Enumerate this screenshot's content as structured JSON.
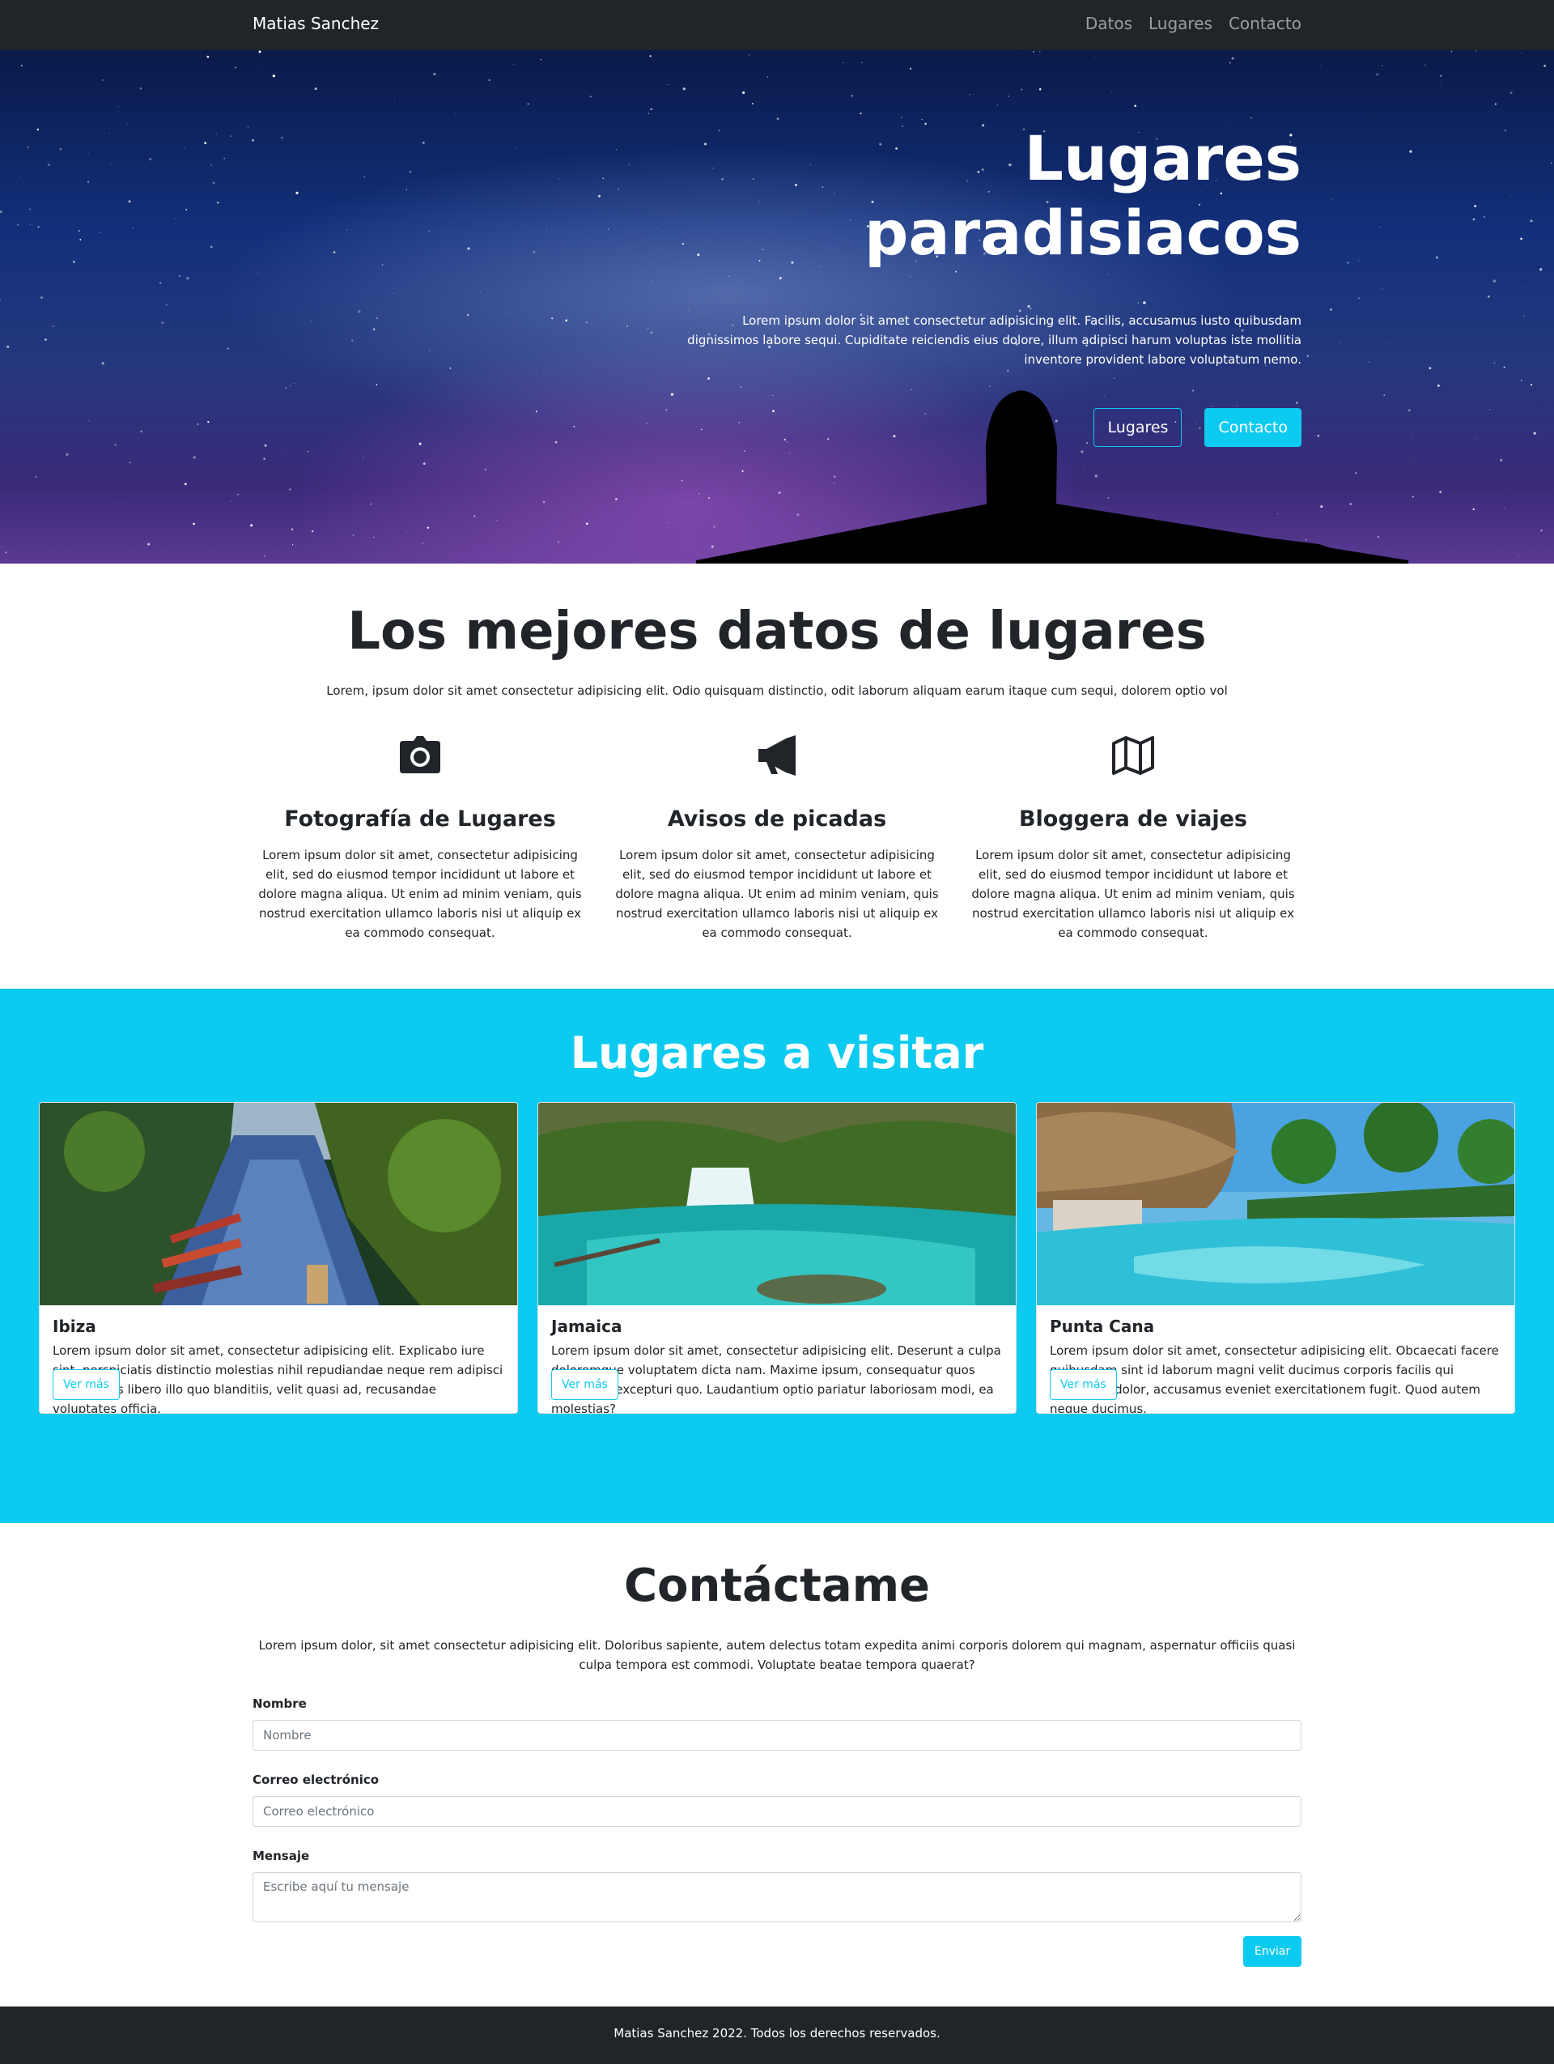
{
  "navbar": {
    "brand": "Matias Sanchez",
    "links": [
      "Datos",
      "Lugares",
      "Contacto"
    ]
  },
  "hero": {
    "title_line1": "Lugares",
    "title_line2": "paradisiacos",
    "text": "Lorem ipsum dolor sit amet consectetur adipisicing elit. Facilis, accusamus iusto quibusdam dignissimos labore sequi. Cupiditate reiciendis eius dolore, illum adipisci harum voluptas iste mollitia inventore provident labore voluptatum nemo.",
    "buttons": {
      "lugares": "Lugares",
      "contacto": "Contacto"
    }
  },
  "features": {
    "title": "Los mejores datos de lugares",
    "subtitle": "Lorem, ipsum dolor sit amet consectetur adipisicing elit. Odio quisquam distinctio, odit laborum aliquam earum itaque cum sequi, dolorem optio vol",
    "items": [
      {
        "icon": "camera-icon",
        "title": "Fotografía de Lugares",
        "text": "Lorem ipsum dolor sit amet, consectetur adipisicing elit, sed do eiusmod tempor incididunt ut labore et dolore magna aliqua. Ut enim ad minim veniam, quis nostrud exercitation ullamco laboris nisi ut aliquip ex ea commodo consequat."
      },
      {
        "icon": "megaphone-icon",
        "title": "Avisos de picadas",
        "text": "Lorem ipsum dolor sit amet, consectetur adipisicing elit, sed do eiusmod tempor incididunt ut labore et dolore magna aliqua. Ut enim ad minim veniam, quis nostrud exercitation ullamco laboris nisi ut aliquip ex ea commodo consequat."
      },
      {
        "icon": "map-icon",
        "title": "Bloggera de viajes",
        "text": "Lorem ipsum dolor sit amet, consectetur adipisicing elit, sed do eiusmod tempor incididunt ut labore et dolore magna aliqua. Ut enim ad minim veniam, quis nostrud exercitation ullamco laboris nisi ut aliquip ex ea commodo consequat."
      }
    ]
  },
  "places": {
    "title": "Lugares a visitar",
    "cards": [
      {
        "title": "Ibiza",
        "text": "Lorem ipsum dolor sit amet, consectetur adipisicing elit. Explicabo iure sint, perspiciatis distinctio molestias nihil repudiandae neque rem adipisci repellendus libero illo quo blanditiis, velit quasi ad, recusandae voluptates officia.",
        "button": "Ver más"
      },
      {
        "title": "Jamaica",
        "text": "Lorem ipsum dolor sit amet, consectetur adipisicing elit. Deserunt a culpa doloremque voluptatem dicta nam. Maxime ipsum, consequatur quos error fuga excepturi quo. Laudantium optio pariatur laboriosam modi, ea molestias?",
        "button": "Ver más"
      },
      {
        "title": "Punta Cana",
        "text": "Lorem ipsum dolor sit amet, consectetur adipisicing elit. Obcaecati facere quibusdam sint id laborum magni velit ducimus corporis facilis qui architecto dolor, accusamus eveniet exercitationem fugit. Quod autem neque ducimus.",
        "button": "Ver más"
      }
    ]
  },
  "contact": {
    "title": "Contáctame",
    "subtitle": "Lorem ipsum dolor, sit amet consectetur adipisicing elit. Doloribus sapiente, autem delectus totam expedita animi corporis dolorem qui magnam, aspernatur officiis quasi culpa tempora est commodi. Voluptate beatae tempora quaerat?",
    "fields": {
      "name_label": "Nombre",
      "name_placeholder": "Nombre",
      "email_label": "Correo electrónico",
      "email_placeholder": "Correo electrónico",
      "message_label": "Mensaje",
      "message_placeholder": "Escribe aquí tu mensaje"
    },
    "submit": "Enviar"
  },
  "footer": {
    "text": "Matias Sanchez 2022. Todos los derechos reservados."
  },
  "colors": {
    "accent": "#0dcaf0",
    "dark": "#212529"
  }
}
